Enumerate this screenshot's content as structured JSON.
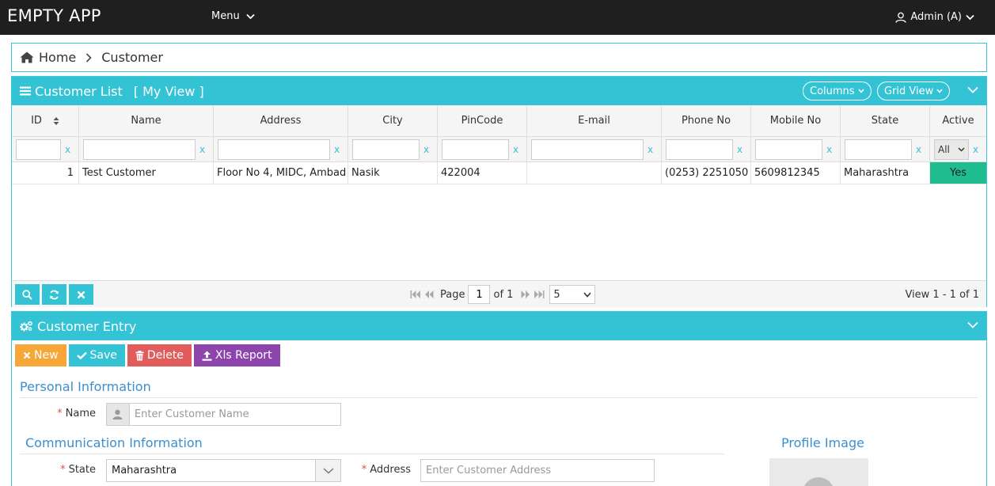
{
  "app": {
    "title": "EMPTY APP",
    "menu_label": "Menu",
    "user_label": "Admin (A)"
  },
  "breadcrumb": {
    "home": "Home",
    "current": "Customer"
  },
  "list_panel": {
    "title": "Customer List",
    "view_label": "[ My View ]",
    "columns_btn": "Columns",
    "gridview_btn": "Grid View",
    "headers": [
      "ID",
      "Name",
      "Address",
      "City",
      "PinCode",
      "E-mail",
      "Phone No",
      "Mobile No",
      "State",
      "Active"
    ],
    "filter_clear": "x",
    "active_filter": "All",
    "rows": [
      {
        "id": "1",
        "name": "Test Customer",
        "address": "Floor No 4, MIDC, Ambad",
        "city": "Nasik",
        "pincode": "422004",
        "email": "",
        "phone": "(0253) 2251050",
        "mobile": "5609812345",
        "state": "Maharashtra",
        "active": "Yes"
      }
    ],
    "pager": {
      "page_label": "Page",
      "page_value": "1",
      "of_label": "of 1",
      "page_size": "5",
      "view_info": "View 1 - 1 of 1"
    }
  },
  "entry_panel": {
    "title": "Customer Entry",
    "buttons": {
      "new": "New",
      "save": "Save",
      "delete": "Delete",
      "xls": "Xls Report"
    },
    "personal_title": "Personal Information",
    "name_label": "Name",
    "name_placeholder": "Enter Customer Name",
    "comm_title": "Communication Information",
    "state_label": "State",
    "state_value": "Maharashtra",
    "address_label": "Address",
    "address_placeholder": "Enter Customer Address",
    "profile_title": "Profile Image",
    "required_mark": "*"
  },
  "colors": {
    "accent": "#33c3d4",
    "topbar": "#1f1f1f",
    "new": "#f7a738",
    "save": "#33c3d4",
    "delete": "#e25c5c",
    "xls": "#8e44ad",
    "active_yes": "#1ebc8e",
    "section": "#3a8fd0"
  }
}
